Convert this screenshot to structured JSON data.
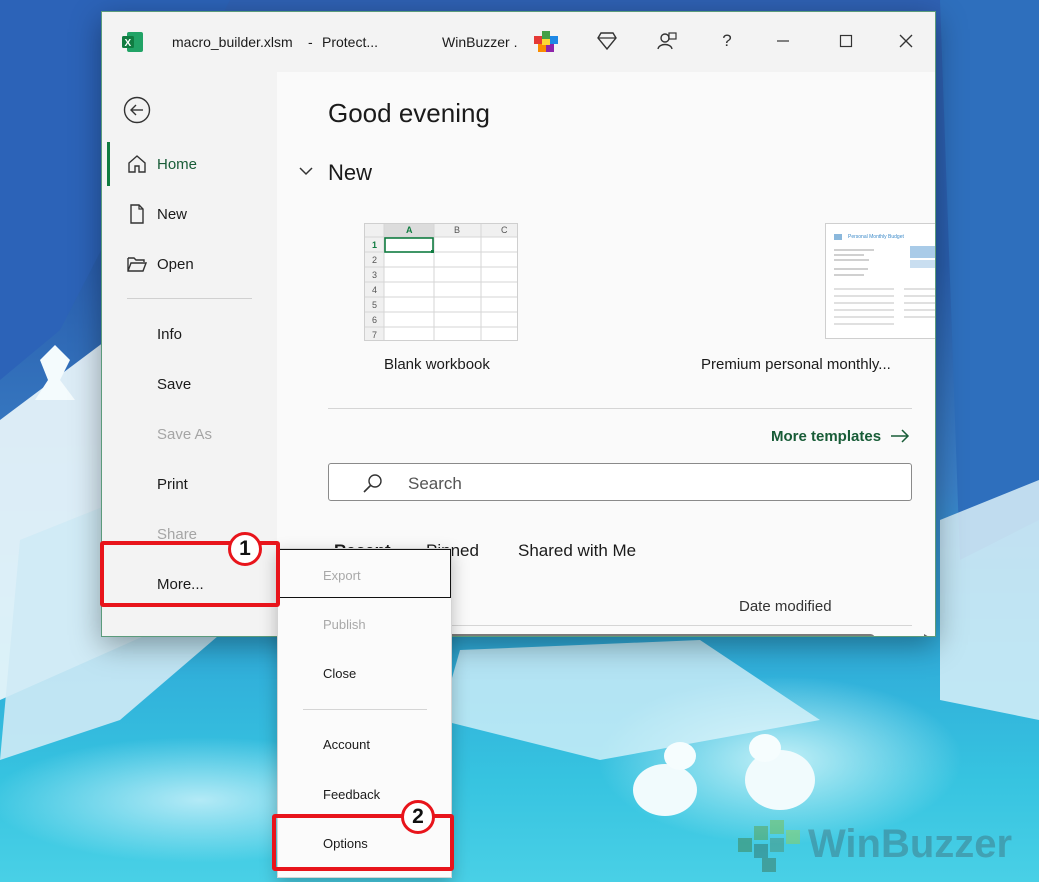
{
  "window": {
    "filename": "macro_builder.xlsm",
    "separator": "-",
    "status": "Protect...",
    "account": "WinBuzzer ."
  },
  "sidebar": {
    "items": [
      {
        "label": "Home"
      },
      {
        "label": "New"
      },
      {
        "label": "Open"
      },
      {
        "label": "Info"
      },
      {
        "label": "Save"
      },
      {
        "label": "Save As"
      },
      {
        "label": "Print"
      },
      {
        "label": "Share"
      },
      {
        "label": "More..."
      }
    ]
  },
  "main": {
    "greeting": "Good evening",
    "new_section_title": "New",
    "templates": [
      {
        "label": "Blank workbook"
      },
      {
        "label": "Premium personal monthly..."
      }
    ],
    "blank_grid": {
      "columns": [
        "A",
        "B",
        "C"
      ],
      "rows": [
        "1",
        "2",
        "3",
        "4",
        "5",
        "6",
        "7"
      ]
    },
    "budget_thumb_title": "Personal Monthly Budget",
    "more_templates": "More templates",
    "search_placeholder": "Search",
    "tabs": [
      {
        "label": "Recent"
      },
      {
        "label": "Pinned"
      },
      {
        "label": "Shared with Me"
      }
    ],
    "column_date_modified": "Date modified"
  },
  "more_menu": {
    "items": [
      {
        "label": "Export"
      },
      {
        "label": "Publish"
      },
      {
        "label": "Close"
      },
      {
        "label": "Account"
      },
      {
        "label": "Feedback"
      },
      {
        "label": "Options"
      }
    ]
  },
  "annotations": {
    "badge_1": "1",
    "badge_2": "2",
    "color": "#e8141b"
  },
  "colors": {
    "excel_green": "#107c41",
    "accent_link": "#185c37"
  }
}
